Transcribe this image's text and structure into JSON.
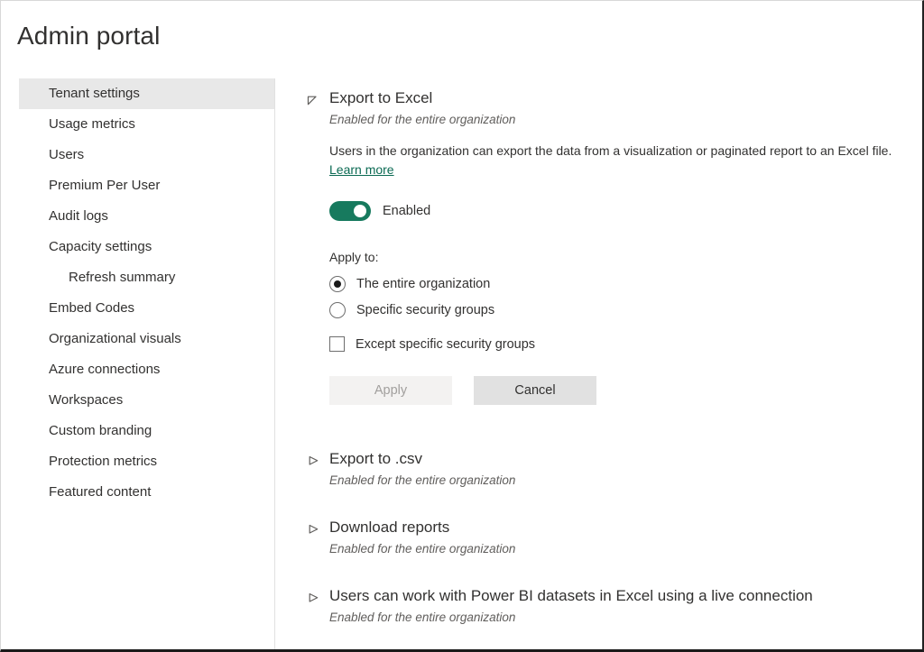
{
  "header": {
    "title": "Admin portal"
  },
  "sidebar": {
    "items": [
      {
        "label": "Tenant settings",
        "selected": true,
        "sub": false
      },
      {
        "label": "Usage metrics",
        "selected": false,
        "sub": false
      },
      {
        "label": "Users",
        "selected": false,
        "sub": false
      },
      {
        "label": "Premium Per User",
        "selected": false,
        "sub": false
      },
      {
        "label": "Audit logs",
        "selected": false,
        "sub": false
      },
      {
        "label": "Capacity settings",
        "selected": false,
        "sub": false
      },
      {
        "label": "Refresh summary",
        "selected": false,
        "sub": true
      },
      {
        "label": "Embed Codes",
        "selected": false,
        "sub": false
      },
      {
        "label": "Organizational visuals",
        "selected": false,
        "sub": false
      },
      {
        "label": "Azure connections",
        "selected": false,
        "sub": false
      },
      {
        "label": "Workspaces",
        "selected": false,
        "sub": false
      },
      {
        "label": "Custom branding",
        "selected": false,
        "sub": false
      },
      {
        "label": "Protection metrics",
        "selected": false,
        "sub": false
      },
      {
        "label": "Featured content",
        "selected": false,
        "sub": false
      }
    ]
  },
  "main": {
    "expanded_setting": {
      "title": "Export to Excel",
      "status": "Enabled for the entire organization",
      "description_before_link": "Users in the organization can export the data from a visualization or paginated report to an Excel file. ",
      "link_label": "Learn more",
      "toggle": {
        "state": "on",
        "label": "Enabled"
      },
      "apply_to_label": "Apply to:",
      "options": [
        {
          "label": "The entire organization",
          "checked": true
        },
        {
          "label": "Specific security groups",
          "checked": false
        }
      ],
      "exception": {
        "label": "Except specific security groups",
        "checked": false
      },
      "buttons": {
        "apply_label": "Apply",
        "apply_disabled": true,
        "cancel_label": "Cancel"
      }
    },
    "collapsed_settings": [
      {
        "title": "Export to .csv",
        "status": "Enabled for the entire organization"
      },
      {
        "title": "Download reports",
        "status": "Enabled for the entire organization"
      },
      {
        "title": "Users can work with Power BI datasets in Excel using a live connection",
        "status": "Enabled for the entire organization"
      }
    ]
  },
  "colors": {
    "toggle_on": "#177a5e",
    "link": "#0b6a53",
    "selected_nav_bg": "#e8e8e8",
    "text": "#323130",
    "muted_text": "#605e5c"
  },
  "icons": {
    "expanded_chevron": "chevron-down-icon",
    "collapsed_chevron": "chevron-right-icon"
  }
}
